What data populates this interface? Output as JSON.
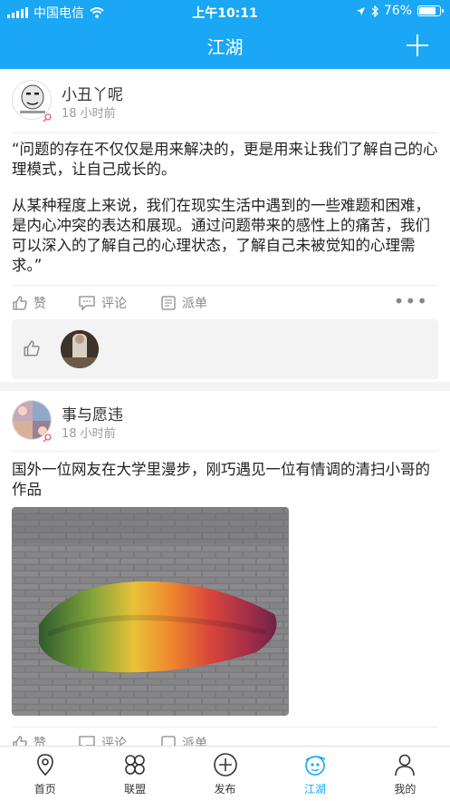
{
  "status_bar": {
    "carrier": "中国电信",
    "time": "上午10:11",
    "battery": "76%",
    "battery_level": 0.76
  },
  "nav": {
    "title": "江湖",
    "add_icon": "plus-icon"
  },
  "posts": [
    {
      "username": "小丑丫呢",
      "time": "18 小时前",
      "paragraphs": [
        "“问题的存在不仅仅是用来解决的，更是用来让我们了解自己的心理模式，让自己成长的。",
        "从某种程度上来说，我们在现实生活中遇到的一些难题和困难，是内心冲突的表达和展现。通过问题带来的感性上的痛苦，我们可以深入的了解自己的心理状态，了解自己未被觉知的心理需求。”"
      ],
      "actions": {
        "like": "赞",
        "comment": "评论",
        "dispatch": "派单"
      }
    },
    {
      "username": "事与愿违",
      "time": "18 小时前",
      "paragraphs": [
        "国外一位网友在大学里漫步，刚巧遇见一位有情调的清扫小哥的作品"
      ],
      "actions": {
        "like": "赞",
        "comment": "评论",
        "dispatch": "派单"
      }
    }
  ],
  "tabbar": {
    "items": [
      {
        "label": "首页",
        "icon": "location-pin-icon"
      },
      {
        "label": "联盟",
        "icon": "clover-icon"
      },
      {
        "label": "发布",
        "icon": "plus-circle-icon"
      },
      {
        "label": "江湖",
        "icon": "planet-face-icon",
        "active": true
      },
      {
        "label": "我的",
        "icon": "user-icon"
      }
    ]
  },
  "colors": {
    "accent": "#1aa7f5",
    "text": "#222222",
    "muted": "#999999"
  }
}
